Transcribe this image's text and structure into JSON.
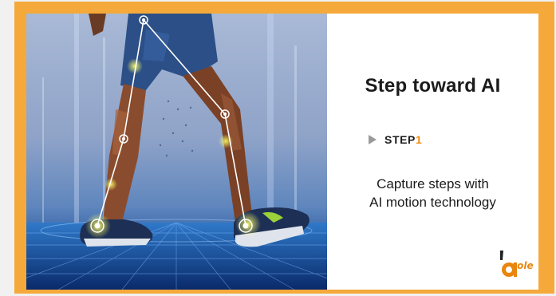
{
  "slide": {
    "headline": "Step toward AI",
    "step_prefix": "STEP",
    "step_number": "1",
    "description_line1": "Capture steps with",
    "description_line2": "AI motion technology"
  },
  "logo": {
    "wordmark": "sole"
  },
  "colors": {
    "frame": "#f4a93a",
    "accent": "#f08c12",
    "step_arrow": "#9a9a9a",
    "panel": "#ffffff"
  },
  "icons": [
    "play-triangle-icon",
    "asole-logo-icon"
  ]
}
